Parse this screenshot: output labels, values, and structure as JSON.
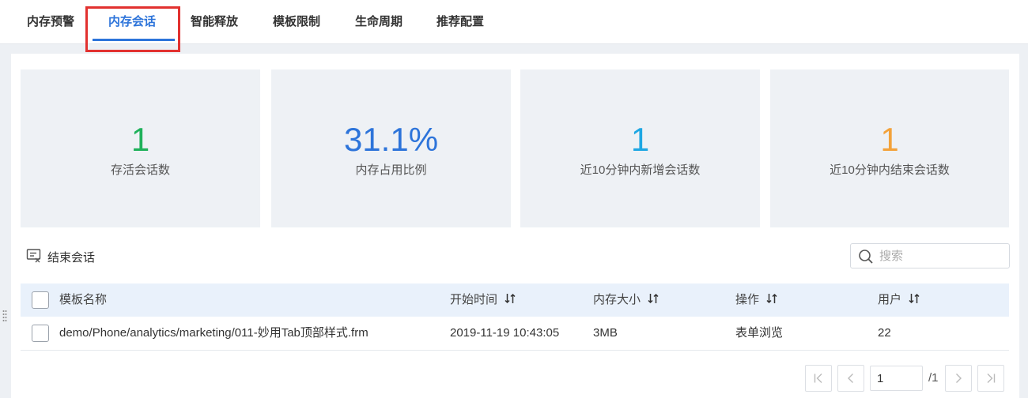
{
  "tabs": [
    {
      "label": "内存预警",
      "active": false
    },
    {
      "label": "内存会话",
      "active": true
    },
    {
      "label": "智能释放",
      "active": false
    },
    {
      "label": "模板限制",
      "active": false
    },
    {
      "label": "生命周期",
      "active": false
    },
    {
      "label": "推荐配置",
      "active": false
    }
  ],
  "stats": [
    {
      "value": "1",
      "label": "存活会话数",
      "color": "#1eb15a"
    },
    {
      "value": "31.1%",
      "label": "内存占用比例",
      "color": "#2d74da"
    },
    {
      "value": "1",
      "label": "近10分钟内新增会话数",
      "color": "#1ea7e3"
    },
    {
      "value": "1",
      "label": "近10分钟内结束会话数",
      "color": "#f3a23a"
    }
  ],
  "toolbar": {
    "end_session_label": "结束会话",
    "search_placeholder": "搜索"
  },
  "table": {
    "columns": [
      "模板名称",
      "开始时间",
      "内存大小",
      "操作",
      "用户"
    ],
    "rows": [
      [
        "demo/Phone/analytics/marketing/011-妙用Tab顶部样式.frm",
        "2019-11-19 10:43:05",
        "3MB",
        "表单浏览",
        "22"
      ]
    ]
  },
  "pagination": {
    "current_page": "1",
    "total_label": "/1"
  },
  "colors": {
    "accent": "#2d74da",
    "highlight_box": "#e2312f"
  }
}
